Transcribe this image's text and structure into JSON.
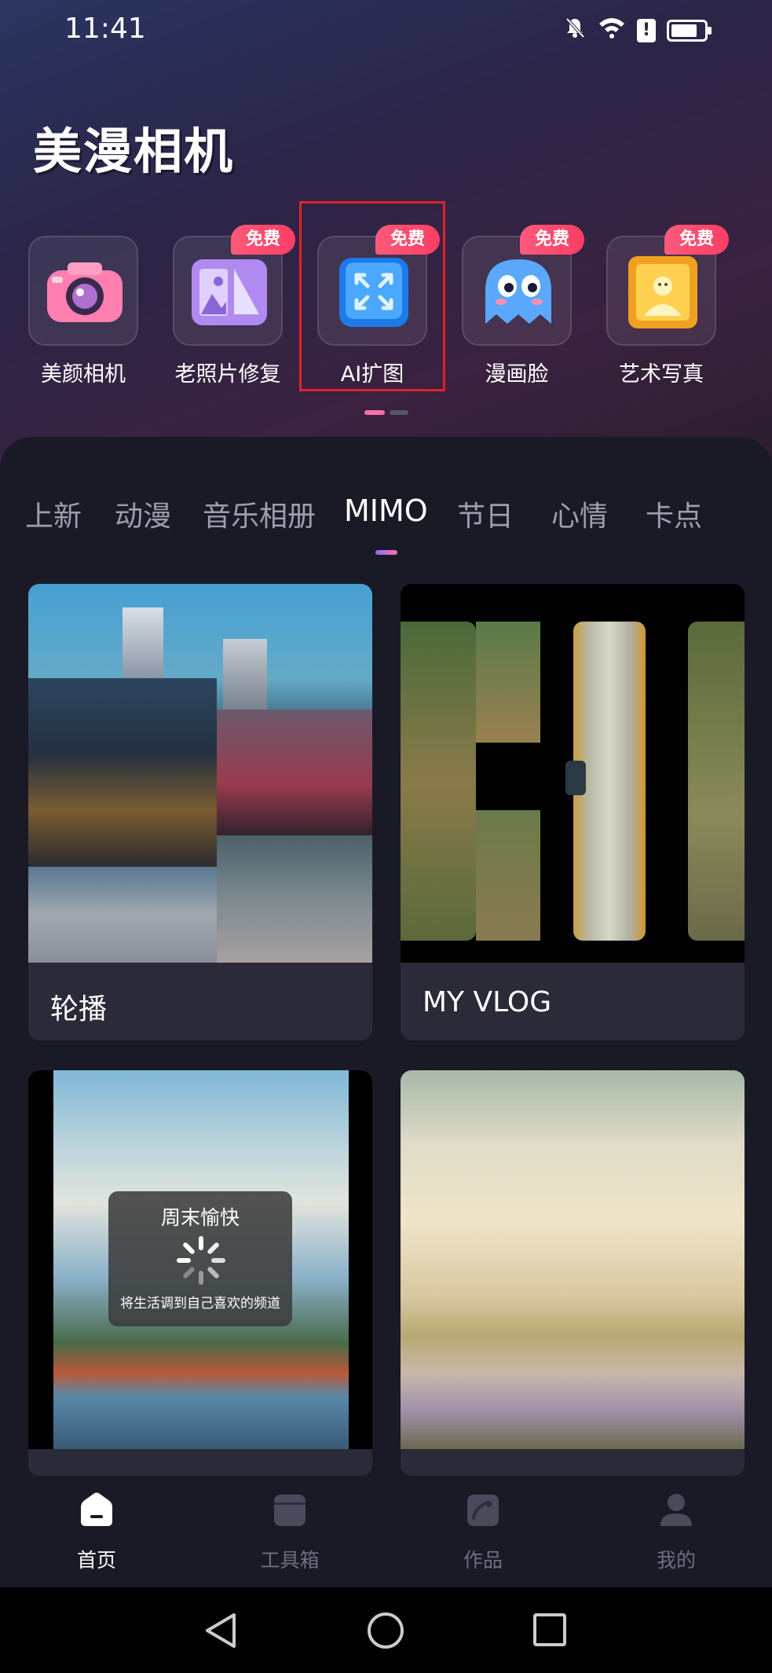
{
  "status_bar": {
    "time": "11:41",
    "icons": [
      "mute-bell-icon",
      "wifi-icon",
      "alert-icon",
      "battery-icon"
    ]
  },
  "app": {
    "title": "美漫相机"
  },
  "features": [
    {
      "label": "美颜相机",
      "icon": "camera-icon",
      "badge": ""
    },
    {
      "label": "老照片修复",
      "icon": "photo-restore-icon",
      "badge": "免费"
    },
    {
      "label": "AI扩图",
      "icon": "expand-icon",
      "badge": "免费"
    },
    {
      "label": "漫画脸",
      "icon": "ghost-icon",
      "badge": "免费"
    },
    {
      "label": "艺术写真",
      "icon": "portrait-icon",
      "badge": "免费"
    }
  ],
  "tabs": {
    "items": [
      "上新",
      "动漫",
      "音乐相册",
      "MIMO",
      "节日",
      "心情",
      "卡点"
    ],
    "active": "MIMO"
  },
  "cards": [
    {
      "title": "轮播"
    },
    {
      "title": "MY VLOG"
    },
    {
      "title": ""
    },
    {
      "title": ""
    }
  ],
  "loading": {
    "title": "周末愉快",
    "subtitle": "将生活调到自己喜欢的频道"
  },
  "bottom_nav": {
    "items": [
      {
        "label": "首页",
        "icon": "home-icon",
        "active": true
      },
      {
        "label": "工具箱",
        "icon": "toolbox-icon",
        "active": false
      },
      {
        "label": "作品",
        "icon": "works-icon",
        "active": false
      },
      {
        "label": "我的",
        "icon": "profile-icon",
        "active": false
      }
    ]
  },
  "colors": {
    "accent_pink": "#ff6fa8",
    "badge_red": "#ff3d64",
    "highlight_red": "#e0212a",
    "background": "#1a1a26"
  }
}
